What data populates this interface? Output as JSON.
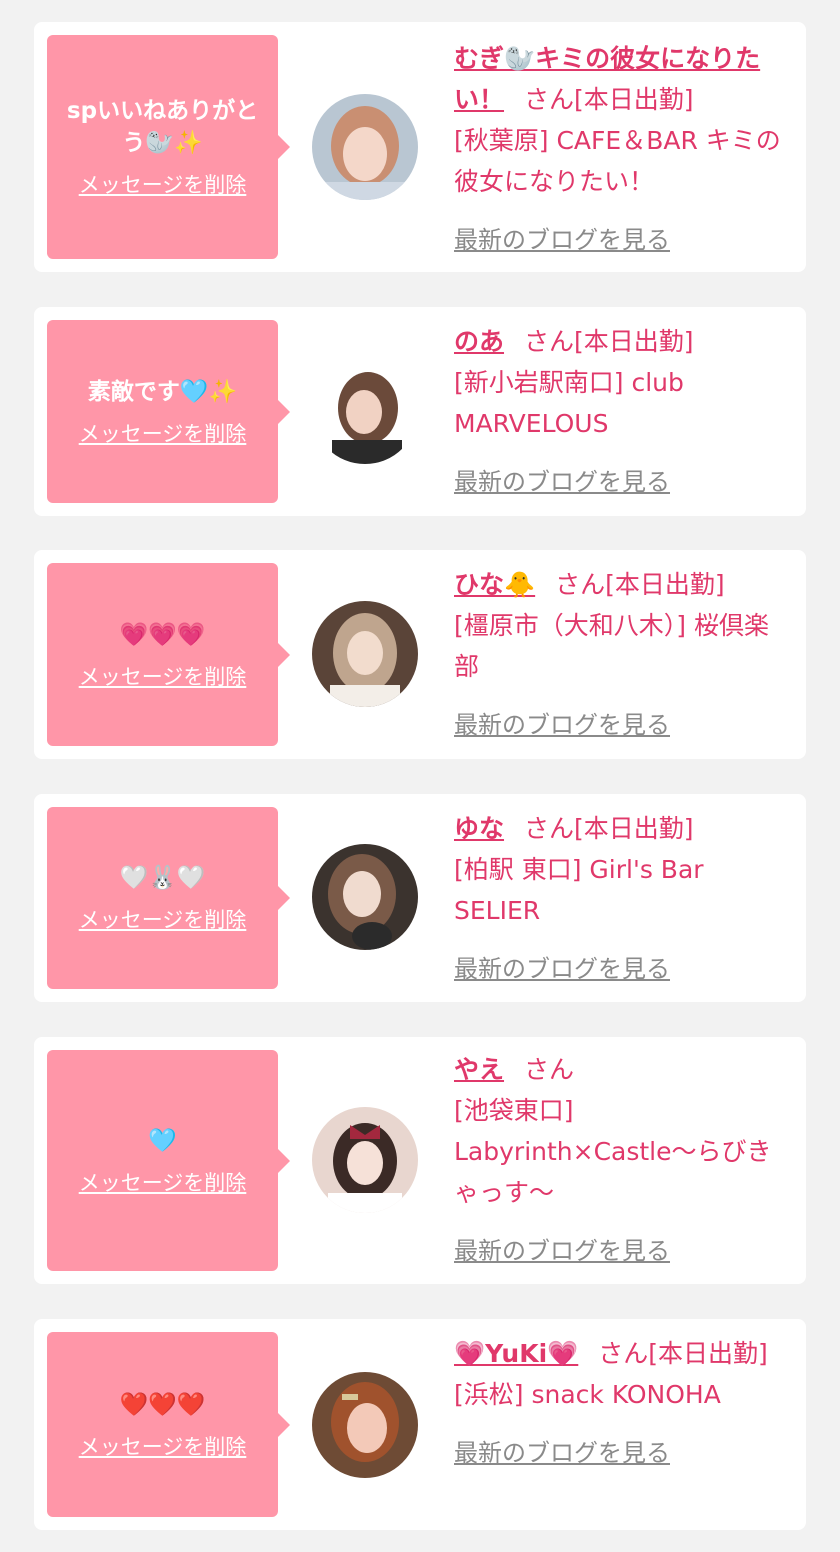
{
  "colors": {
    "page_background": "#f2f2f2",
    "card_background": "#ffffff",
    "bubble_pink": "#ff96a8",
    "accent_pink": "#e0386a",
    "link_gray": "#8a8a8a"
  },
  "likes": [
    {
      "message": "spいいねありがとう🦭✨",
      "delete_label": "メッセージを削除",
      "name": "むぎ🦭キミの彼女になりたい！",
      "san_label": "さん[本日出勤]",
      "shop": "[秋葉原] CAFE＆BAR キミの彼女になりたい！",
      "blog_label": "最新のブログを見る",
      "avatar_icon": "profile-photo"
    },
    {
      "message": "素敵です🩵✨",
      "delete_label": "メッセージを削除",
      "name": "のあ",
      "san_label": "さん[本日出勤]",
      "shop": "[新小岩駅南口] club MARVELOUS",
      "blog_label": "最新のブログを見る",
      "avatar_icon": "profile-photo"
    },
    {
      "message": "💗💗💗",
      "delete_label": "メッセージを削除",
      "name": "ひな🐥",
      "san_label": "さん[本日出勤]",
      "shop": "[橿原市（大和八木）] 桜倶楽部",
      "blog_label": "最新のブログを見る",
      "avatar_icon": "profile-photo"
    },
    {
      "message": "🤍🐰🤍",
      "delete_label": "メッセージを削除",
      "name": "ゆな",
      "san_label": "さん[本日出勤]",
      "shop": "[柏駅 東口] Girl's Bar SELIER",
      "blog_label": "最新のブログを見る",
      "avatar_icon": "profile-photo"
    },
    {
      "message": "🩵",
      "delete_label": "メッセージを削除",
      "name": "やえ",
      "san_label": "さん",
      "shop": "[池袋東口] Labyrinth×Castle～らびきゃっす～",
      "blog_label": "最新のブログを見る",
      "avatar_icon": "profile-photo"
    },
    {
      "message": "❤️❤️❤️",
      "delete_label": "メッセージを削除",
      "name": "💗YuKi💗",
      "san_label": "さん[本日出勤]",
      "shop": "[浜松] snack KONOHA",
      "blog_label": "最新のブログを見る",
      "avatar_icon": "profile-photo"
    }
  ]
}
